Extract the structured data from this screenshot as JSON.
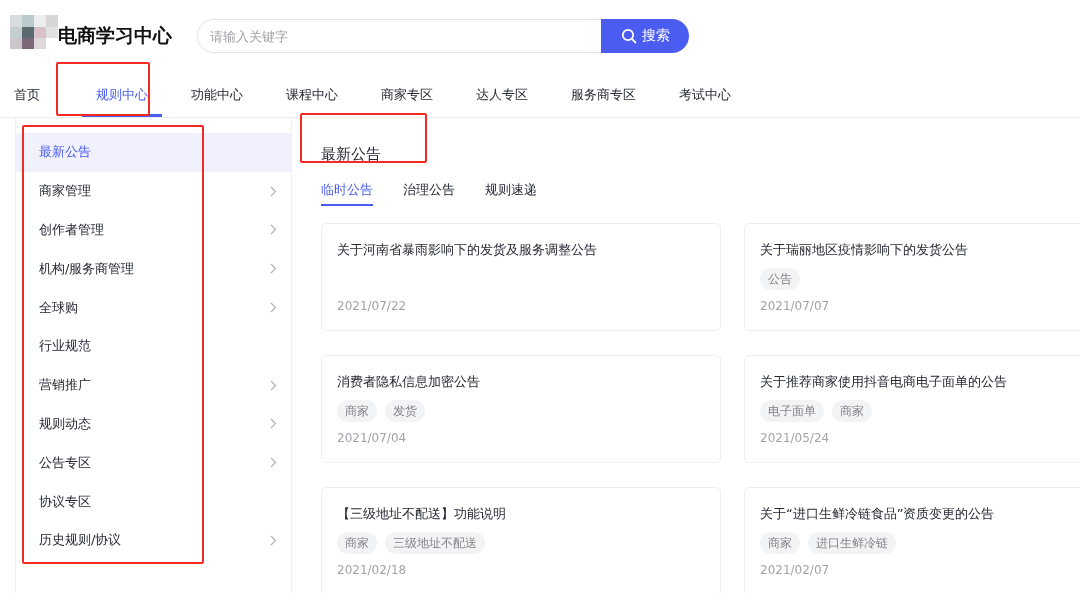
{
  "header": {
    "logo_text": "电商学习中心",
    "search": {
      "placeholder": "请输入关键字",
      "button": "搜索"
    }
  },
  "nav": [
    {
      "label": "首页",
      "selected": false
    },
    {
      "label": "规则中心",
      "selected": true
    },
    {
      "label": "功能中心",
      "selected": false
    },
    {
      "label": "课程中心",
      "selected": false
    },
    {
      "label": "商家专区",
      "selected": false
    },
    {
      "label": "达人专区",
      "selected": false
    },
    {
      "label": "服务商专区",
      "selected": false
    },
    {
      "label": "考试中心",
      "selected": false
    }
  ],
  "sidebar": {
    "items": [
      {
        "label": "最新公告",
        "selected": true,
        "expandable": false
      },
      {
        "label": "商家管理",
        "selected": false,
        "expandable": true
      },
      {
        "label": "创作者管理",
        "selected": false,
        "expandable": true
      },
      {
        "label": "机构/服务商管理",
        "selected": false,
        "expandable": true
      },
      {
        "label": "全球购",
        "selected": false,
        "expandable": true
      },
      {
        "label": "行业规范",
        "selected": false,
        "expandable": false
      },
      {
        "label": "营销推广",
        "selected": false,
        "expandable": true
      },
      {
        "label": "规则动态",
        "selected": false,
        "expandable": true
      },
      {
        "label": "公告专区",
        "selected": false,
        "expandable": true
      },
      {
        "label": "协议专区",
        "selected": false,
        "expandable": false
      },
      {
        "label": "历史规则/协议",
        "selected": false,
        "expandable": true
      }
    ]
  },
  "content": {
    "title": "最新公告",
    "tabs": [
      {
        "label": "临时公告",
        "selected": true
      },
      {
        "label": "治理公告",
        "selected": false
      },
      {
        "label": "规则速递",
        "selected": false
      }
    ],
    "cards": [
      {
        "title": "关于河南省暴雨影响下的发货及服务调整公告",
        "date": "2021/07/22"
      },
      {
        "title": "关于瑞丽地区疫情影响下的发货公告",
        "tags": [
          "公告"
        ],
        "date": "2021/07/07"
      },
      {
        "title": "消费者隐私信息加密公告",
        "tags": [
          "商家",
          "发货"
        ],
        "date": "2021/07/04"
      },
      {
        "title": "关于推荐商家使用抖音电商电子面单的公告",
        "tags": [
          "电子面单",
          "商家"
        ],
        "date": "2021/05/24"
      },
      {
        "title": "【三级地址不配送】功能说明",
        "tags": [
          "商家",
          "三级地址不配送"
        ],
        "date": "2021/02/18"
      },
      {
        "title": "关于“进口生鲜冷链食品”资质变更的公告",
        "tags": [
          "商家",
          "进口生鲜冷链"
        ],
        "date": "2021/02/07"
      }
    ]
  }
}
